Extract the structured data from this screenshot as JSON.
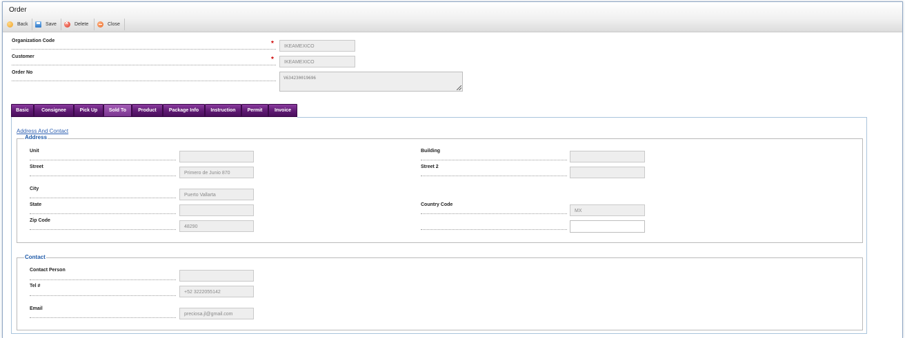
{
  "window": {
    "title": "Order"
  },
  "toolbar": {
    "back": "Back",
    "save": "Save",
    "delete": "Delete",
    "close": "Close"
  },
  "header_fields": {
    "org_code": {
      "label": "Organization Code",
      "value": "IKEAMEXICO",
      "required": true
    },
    "customer": {
      "label": "Customer",
      "value": "IKEAMEXICO",
      "required": true
    },
    "order_no": {
      "label": "Order No",
      "value": "V634230019696"
    }
  },
  "tabs": [
    "Basic",
    "Consignee",
    "Pick Up",
    "Sold To",
    "Product",
    "Package Info",
    "Instruction",
    "Permit",
    "Invoice"
  ],
  "active_tab": "Sold To",
  "section_link": "Address And Contact",
  "address": {
    "legend": "Address",
    "unit": {
      "label": "Unit",
      "value": ""
    },
    "building": {
      "label": "Building",
      "value": ""
    },
    "street": {
      "label": "Street",
      "value": "Primero de Junio 870"
    },
    "street2": {
      "label": "Street 2",
      "value": ""
    },
    "city": {
      "label": "City",
      "value": "Puerto Vallarta"
    },
    "state": {
      "label": "State",
      "value": ""
    },
    "country_code": {
      "label": "Country Code",
      "value": "MX"
    },
    "zip": {
      "label": "Zip Code",
      "value": "48290"
    },
    "extra": {
      "label": "",
      "value": ""
    }
  },
  "contact": {
    "legend": "Contact",
    "person": {
      "label": "Contact Person",
      "value": ""
    },
    "tel": {
      "label": "Tel #",
      "value": "+52 3222055142"
    },
    "email": {
      "label": "Email",
      "value": "preciosa.jl@gmail.com"
    }
  },
  "colors": {
    "tab_bg": "#5e1a72",
    "tab_active_bg": "#7a3690",
    "legend": "#1f5aa8",
    "required": "#cc0000",
    "link": "#2a5db0"
  }
}
